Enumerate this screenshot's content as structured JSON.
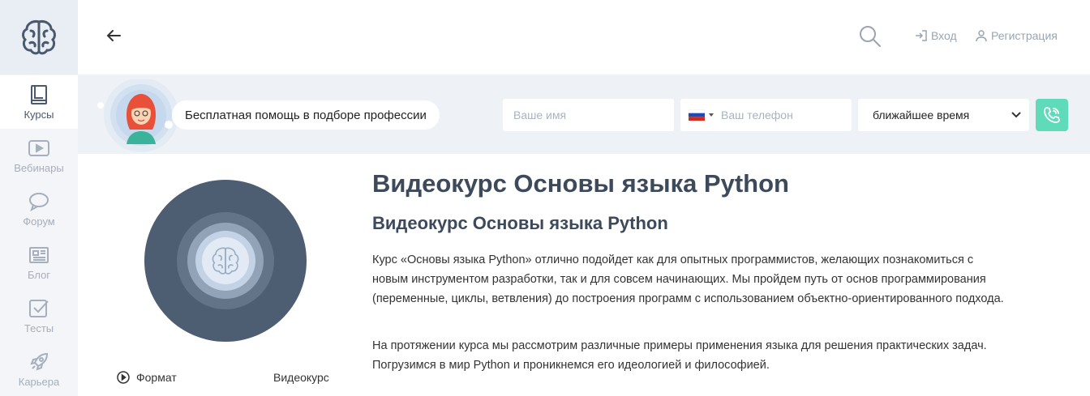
{
  "sidebar": {
    "items": [
      {
        "label": "Курсы",
        "icon": "book-icon"
      },
      {
        "label": "Вебинары",
        "icon": "play-icon"
      },
      {
        "label": "Форум",
        "icon": "chat-icon"
      },
      {
        "label": "Блог",
        "icon": "newspaper-icon"
      },
      {
        "label": "Тесты",
        "icon": "checkbox-icon"
      },
      {
        "label": "Карьера",
        "icon": "rocket-icon"
      }
    ]
  },
  "header": {
    "login": "Вход",
    "register": "Регистрация"
  },
  "banner": {
    "help_text": "Бесплатная помощь в подборе профессии",
    "name_placeholder": "Ваше имя",
    "phone_placeholder": "Ваш телефон",
    "time_value": "ближайшее время"
  },
  "course": {
    "title": "Видеокурс Основы языка Python",
    "subtitle": "Видеокурс Основы языка Python",
    "description_1": "Курс «Основы языка Python» отлично подойдет как для опытных программистов, желающих познакомиться с новым инструментом разработки, так и для совсем начинающих. Мы пройдем путь от основ программирования (переменные, циклы, ветвления) до построения программ с использованием объектно-ориентированного подхода.",
    "description_2": "На протяжении курса мы рассмотрим различные примеры применения языка для решения практических задач. Погрузимся в мир Python и проникнемся его идеологией и философией.",
    "format_label": "Формат",
    "format_value": "Видеокурс"
  },
  "colors": {
    "accent": "#5fdbb9",
    "title": "#3d4a5c",
    "cover": "#4d5e72"
  }
}
